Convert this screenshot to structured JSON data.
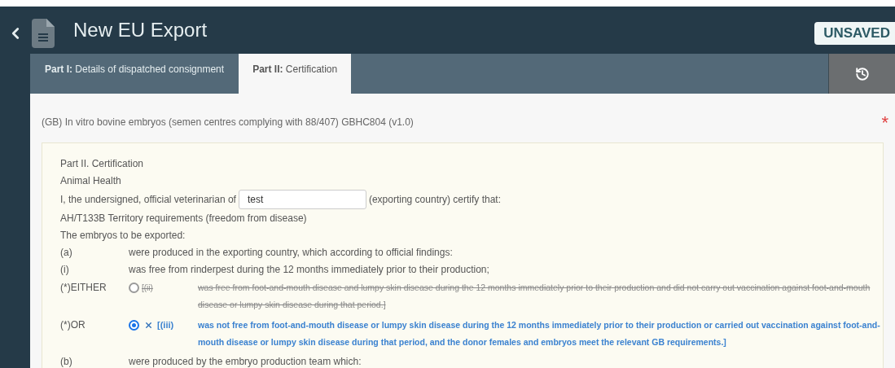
{
  "header": {
    "title": "New EU Export",
    "status": "UNSAVED"
  },
  "tabs": [
    {
      "prefix": "Part I:",
      "label": "Details of dispatched consignment",
      "selected": false
    },
    {
      "prefix": "Part II:",
      "label": "Certification",
      "selected": true
    }
  ],
  "certificate_title": "(GB) In vitro bovine embryos (semen centres complying with 88/407) GBHC804 (v1.0)",
  "required_mark": "*",
  "body": [
    {
      "kind": "text",
      "text": "Part II. Certification"
    },
    {
      "kind": "text",
      "text": "Animal Health"
    },
    {
      "kind": "field_line",
      "before": "I, the undersigned, official veterinarian of",
      "value": "test",
      "after": "(exporting country) certify that:"
    },
    {
      "kind": "text",
      "text": "AH/T133B Territory requirements (freedom from disease)"
    },
    {
      "kind": "text",
      "text": "The embryos to be exported:"
    },
    {
      "kind": "clause",
      "label": "(a)",
      "text": "were produced in the exporting country, which according to official findings:"
    },
    {
      "kind": "clause",
      "label": "(i)",
      "text": "was free from rinderpest during the 12 months immediately prior to their production;"
    },
    {
      "kind": "option",
      "label": "(*)EITHER",
      "ref": "[(ii)",
      "selected": false,
      "text": "was free from foot-and-mouth disease and lumpy skin disease during the 12 months immediately prior to their production and did not carry out vaccination against foot-and-mouth disease or lumpy skin disease during that period.]"
    },
    {
      "kind": "option",
      "label": "(*)OR",
      "ref": "[(iii)",
      "selected": true,
      "text": "was not free from foot-and-mouth disease or lumpy skin disease during the 12 months immediately prior to their production or carried out vaccination against foot-and-mouth disease or lumpy skin disease during that period, and the donor females and embryos meet the relevant GB requirements.]"
    },
    {
      "kind": "clause",
      "label": "(b)",
      "text": "were produced by the embryo production team which:"
    }
  ]
}
